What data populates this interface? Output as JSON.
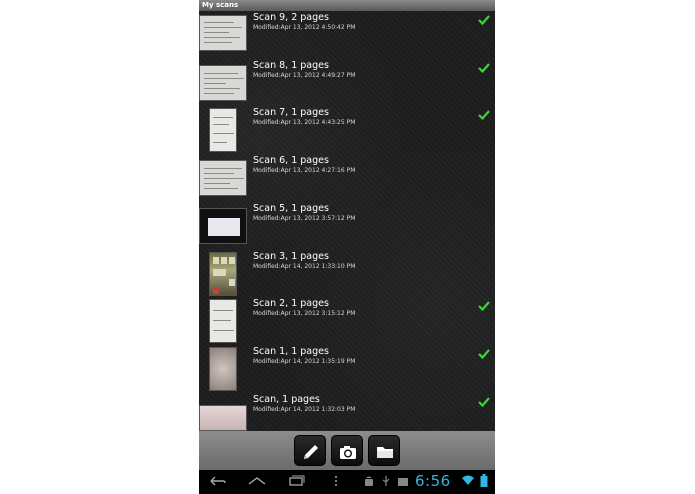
{
  "app": {
    "title": "My scans"
  },
  "scans": [
    {
      "title": "Scan 9, 2 pages",
      "modified": "Modified:Apr 13, 2012 4:50:42 PM",
      "checked": true,
      "thumb": "doc"
    },
    {
      "title": "Scan 8, 1 pages",
      "modified": "Modified:Apr 13, 2012 4:49:27 PM",
      "checked": true,
      "thumb": "doc"
    },
    {
      "title": "Scan 7, 1 pages",
      "modified": "Modified:Apr 13, 2012 4:43:25 PM",
      "checked": true,
      "thumb": "page"
    },
    {
      "title": "Scan 6, 1 pages",
      "modified": "Modified:Apr 13, 2012 4:27:16 PM",
      "checked": false,
      "thumb": "doc"
    },
    {
      "title": "Scan 5, 1 pages",
      "modified": "Modified:Apr 13, 2012 3:57:12 PM",
      "checked": false,
      "thumb": "screen"
    },
    {
      "title": "Scan 3, 1 pages",
      "modified": "Modified:Apr 14, 2012 1:33:10 PM",
      "checked": false,
      "thumb": "photo"
    },
    {
      "title": "Scan 2, 1 pages",
      "modified": "Modified:Apr 13, 2012 3:15:12 PM",
      "checked": true,
      "thumb": "page"
    },
    {
      "title": "Scan 1, 1 pages",
      "modified": "Modified:Apr 14, 2012 1:35:19 PM",
      "checked": true,
      "thumb": "beige"
    },
    {
      "title": "Scan, 1 pages",
      "modified": "Modified:Apr 14, 2012 1:32:03 PM",
      "checked": true,
      "thumb": "pinkish"
    }
  ],
  "toolbar": {
    "buttons": [
      {
        "icon": "pencil-icon"
      },
      {
        "icon": "camera-icon"
      },
      {
        "icon": "folder-icon"
      }
    ]
  },
  "status": {
    "clock": "6:56"
  },
  "colors": {
    "check": "#3fd23f",
    "clock": "#33b5e5"
  }
}
